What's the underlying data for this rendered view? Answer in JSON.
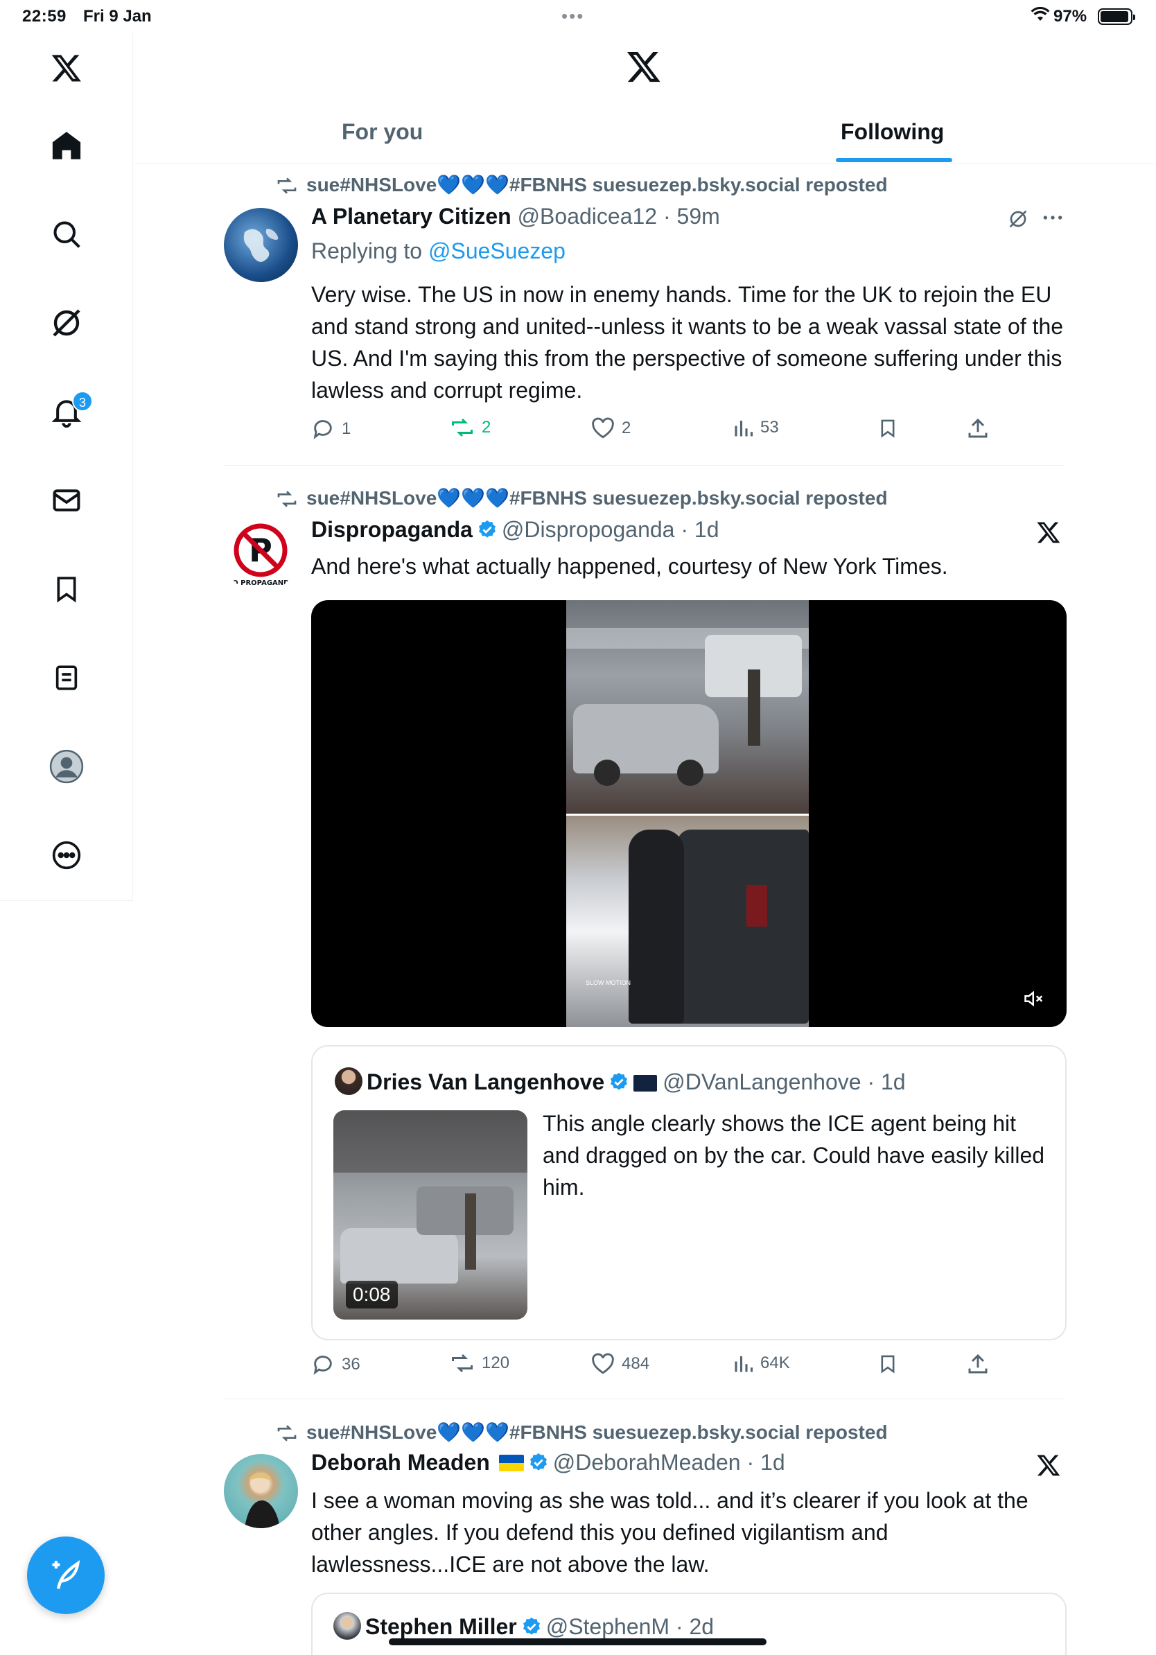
{
  "status": {
    "time": "22:59",
    "date": "Fri 9 Jan",
    "battery": "97%"
  },
  "sidebar": {
    "notifications_badge": "3"
  },
  "tabs": {
    "for_you": "For you",
    "following": "Following"
  },
  "posts": [
    {
      "repost": "sue#NHSLove💙💙💙#FBNHS suesuezep.bsky.social reposted",
      "name": "A Planetary Citizen",
      "handle": "@Boadicea12 · 59m",
      "reply_prefix": "Replying to ",
      "reply_to": "@SueSuezep",
      "text": "Very wise. The US in now in enemy hands. Time for the UK to rejoin the EU and stand strong and united--unless it wants to be a weak vassal state of the US. And I'm saying this from the perspective of someone suffering under this lawless and corrupt regime.",
      "replies": "1",
      "reposts": "2",
      "likes": "2",
      "views": "53"
    },
    {
      "repost": "sue#NHSLove💙💙💙#FBNHS suesuezep.bsky.social reposted",
      "name": "Dispropaganda",
      "handle": "@Dispropoganda · 1d",
      "avatar_caption": "NO PROPAGANDA",
      "text": "And here's what actually happened, courtesy of New York Times.",
      "video_caption": "SLOW MOTION",
      "quote": {
        "name": "Dries Van Langenhove",
        "handle": "@DVanLangenhove · 1d",
        "text": "This angle clearly shows the ICE agent being hit and dragged on by the car. Could have easily killed him.",
        "duration": "0:08"
      },
      "replies": "36",
      "reposts": "120",
      "likes": "484",
      "views": "64K"
    },
    {
      "repost": "sue#NHSLove💙💙💙#FBNHS suesuezep.bsky.social reposted",
      "name": "Deborah Meaden",
      "handle": "@DeborahMeaden · 1d",
      "text": "I see a woman moving as she was told... and it’s clearer if you look at the other angles. If you defend this you defined vigilantism and lawlessness...ICE are not above the law.",
      "quote": {
        "name": "Stephen Miller",
        "handle": "@StephenM · 2d"
      }
    }
  ],
  "colors": {
    "accent": "#1d9bf0",
    "muted": "#536471",
    "repost_green": "#00ba7c",
    "verified": "#1d9bf0"
  }
}
